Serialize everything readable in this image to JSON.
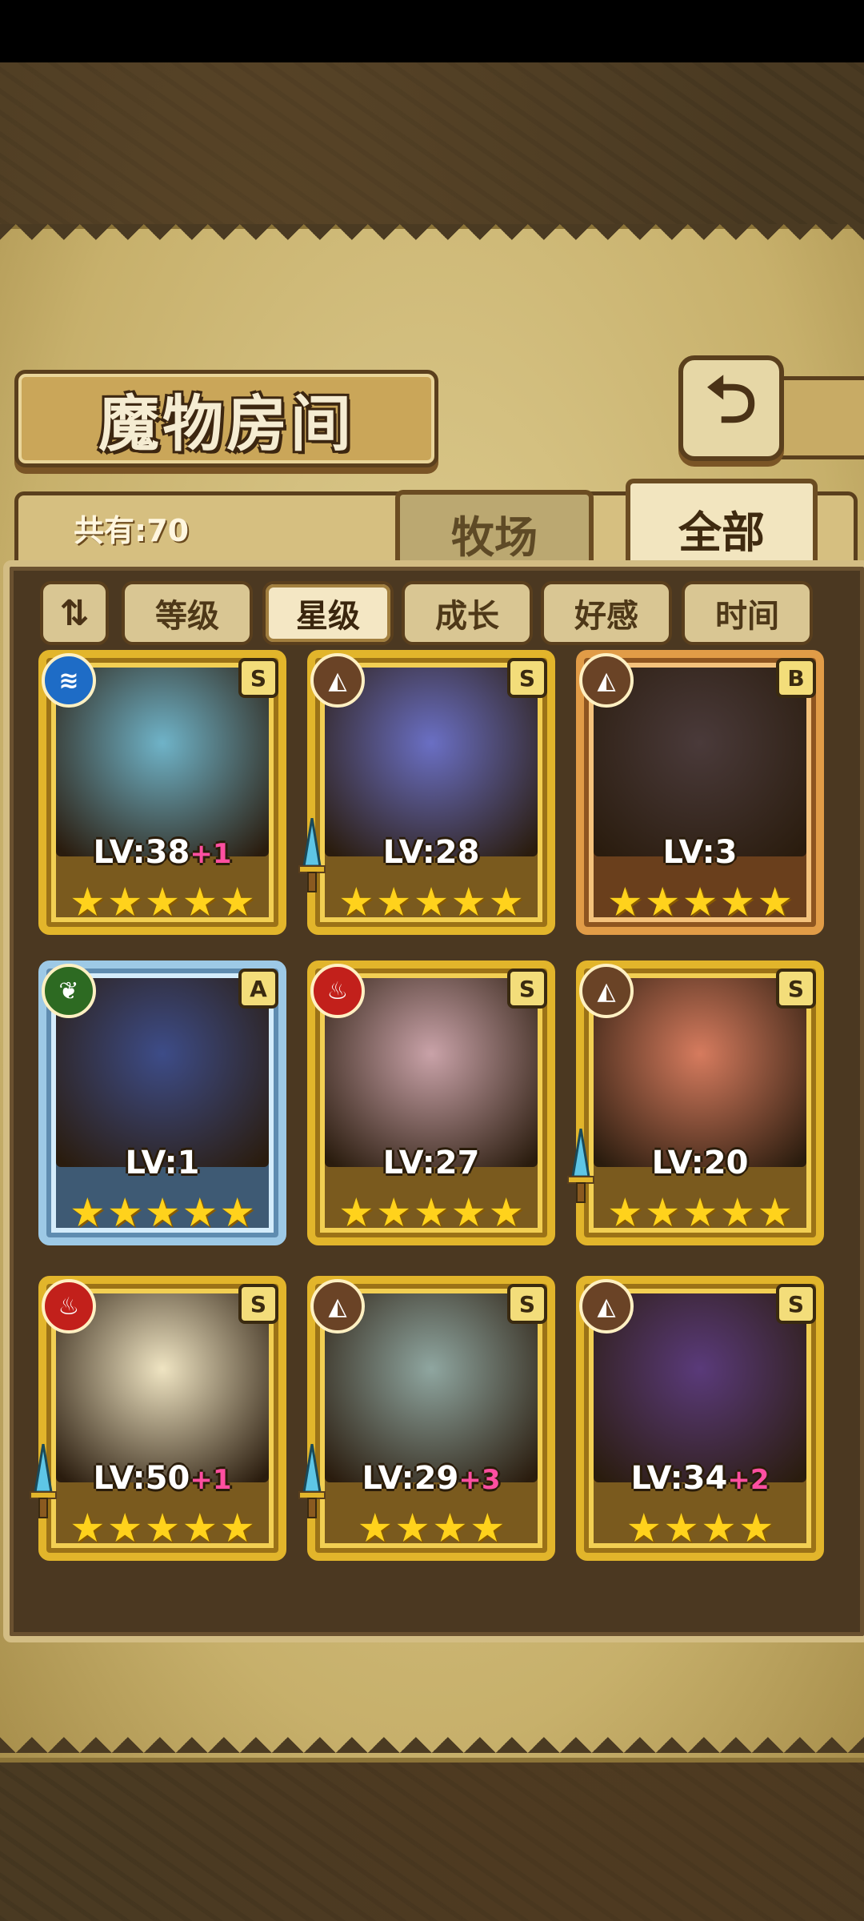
{
  "title": "魔物房间",
  "back_icon": "back-return-icon",
  "count_label": "共有:70",
  "tabs": {
    "ranch": "牧场",
    "all": "全部",
    "selected": "all"
  },
  "sort": {
    "toggle_icon": "sort-order-icon",
    "buttons": [
      "等级",
      "星级",
      "成长",
      "好感",
      "时间"
    ],
    "active": "星级"
  },
  "monsters": [
    {
      "element": "water",
      "rank": "S",
      "level": "LV:38",
      "bonus": "+1",
      "stars": 5,
      "frame": "gold",
      "sword": false,
      "color": "#6fb3c8"
    },
    {
      "element": "earth",
      "rank": "S",
      "level": "LV:28",
      "bonus": "",
      "stars": 5,
      "frame": "gold",
      "sword": true,
      "color": "#6a6fc4"
    },
    {
      "element": "earth",
      "rank": "B",
      "level": "LV:3",
      "bonus": "",
      "stars": 5,
      "frame": "bronze",
      "sword": false,
      "color": "#4a3a3a"
    },
    {
      "element": "wood",
      "rank": "A",
      "level": "LV:1",
      "bonus": "",
      "stars": 5,
      "frame": "blue",
      "sword": false,
      "color": "#3d4c88"
    },
    {
      "element": "fire",
      "rank": "S",
      "level": "LV:27",
      "bonus": "",
      "stars": 5,
      "frame": "gold",
      "sword": false,
      "color": "#c9a2a8"
    },
    {
      "element": "earth",
      "rank": "S",
      "level": "LV:20",
      "bonus": "",
      "stars": 5,
      "frame": "gold",
      "sword": true,
      "color": "#d67b5e"
    },
    {
      "element": "fire",
      "rank": "S",
      "level": "LV:50",
      "bonus": "+1",
      "stars": 5,
      "frame": "gold",
      "sword": true,
      "color": "#efe4c2"
    },
    {
      "element": "earth",
      "rank": "S",
      "level": "LV:29",
      "bonus": "+3",
      "stars": 4,
      "frame": "gold",
      "sword": true,
      "color": "#8fa6a0"
    },
    {
      "element": "earth",
      "rank": "S",
      "level": "LV:34",
      "bonus": "+2",
      "stars": 4,
      "frame": "gold",
      "sword": false,
      "color": "#5a3a7a"
    }
  ]
}
